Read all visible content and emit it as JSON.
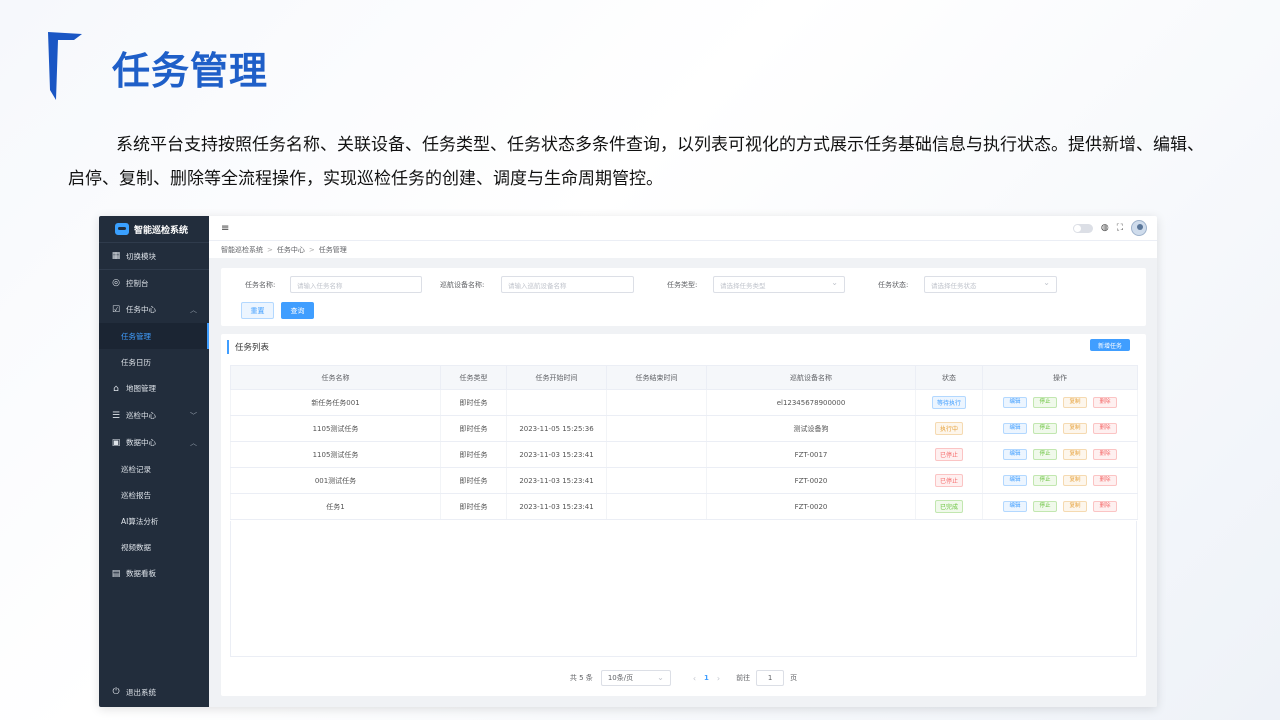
{
  "slide": {
    "title": "任务管理",
    "description": "系统平台支持按照任务名称、关联设备、任务类型、任务状态多条件查询，以列表可视化的方式展示任务基础信息与执行状态。提供新增、编辑、启停、复制、删除等全流程操作，实现巡检任务的创建、调度与生命周期管控。",
    "accent_color": "#1f5fc8"
  },
  "sidebar": {
    "app_name": "智能巡检系统",
    "switch_module": "切换模块",
    "items": [
      {
        "label": "控制台",
        "icon": "dashboard-icon"
      },
      {
        "label": "任务中心",
        "icon": "task-icon",
        "expanded": true
      },
      {
        "label": "地图管理",
        "icon": "map-icon"
      },
      {
        "label": "巡检中心",
        "icon": "inspection-icon",
        "expanded": false
      },
      {
        "label": "数据中心",
        "icon": "data-icon",
        "expanded": true
      },
      {
        "label": "数据看板",
        "icon": "board-icon"
      }
    ],
    "task_sub": [
      "任务管理",
      "任务日历"
    ],
    "data_sub": [
      "巡检记录",
      "巡检报告",
      "AI算法分析",
      "视频数据"
    ],
    "logout": "退出系统"
  },
  "breadcrumb": [
    "智能巡检系统",
    "任务中心",
    "任务管理"
  ],
  "filters": {
    "task_name_label": "任务名称:",
    "task_name_placeholder": "请输入任务名称",
    "device_label": "巡航设备名称:",
    "device_placeholder": "请输入巡航设备名称",
    "type_label": "任务类型:",
    "type_placeholder": "请选择任务类型",
    "status_label": "任务状态:",
    "status_placeholder": "请选择任务状态",
    "reset": "重置",
    "query": "查询"
  },
  "list": {
    "title": "任务列表",
    "new_button": "新增任务",
    "columns": [
      "任务名称",
      "任务类型",
      "任务开始时间",
      "任务结束时间",
      "巡航设备名称",
      "状态",
      "操作"
    ],
    "actions": [
      "编辑",
      "停止",
      "复制",
      "删除"
    ],
    "rows": [
      {
        "name": "新任务任务001",
        "type": "即时任务",
        "start": "",
        "end": "",
        "device": "el12345678900000",
        "status": "等待执行",
        "status_class": "st-wait"
      },
      {
        "name": "1105测试任务",
        "type": "即时任务",
        "start": "2023-11-05 15:25:36",
        "end": "",
        "device": "测试设备狗",
        "status": "执行中",
        "status_class": "st-run"
      },
      {
        "name": "1105测试任务",
        "type": "即时任务",
        "start": "2023-11-03 15:23:41",
        "end": "",
        "device": "FZT-0017",
        "status": "已停止",
        "status_class": "st-stop"
      },
      {
        "name": "001测试任务",
        "type": "即时任务",
        "start": "2023-11-03 15:23:41",
        "end": "",
        "device": "FZT-0020",
        "status": "已停止",
        "status_class": "st-stop"
      },
      {
        "name": "任务1",
        "type": "即时任务",
        "start": "2023-11-03 15:23:41",
        "end": "",
        "device": "FZT-0020",
        "status": "已完成",
        "status_class": "st-done"
      }
    ]
  },
  "pagination": {
    "total": "共 5 条",
    "page_size": "10条/页",
    "prev": "‹",
    "current": "1",
    "next": "›",
    "goto_label": "前往",
    "goto_value": "1",
    "page_suffix": "页"
  }
}
